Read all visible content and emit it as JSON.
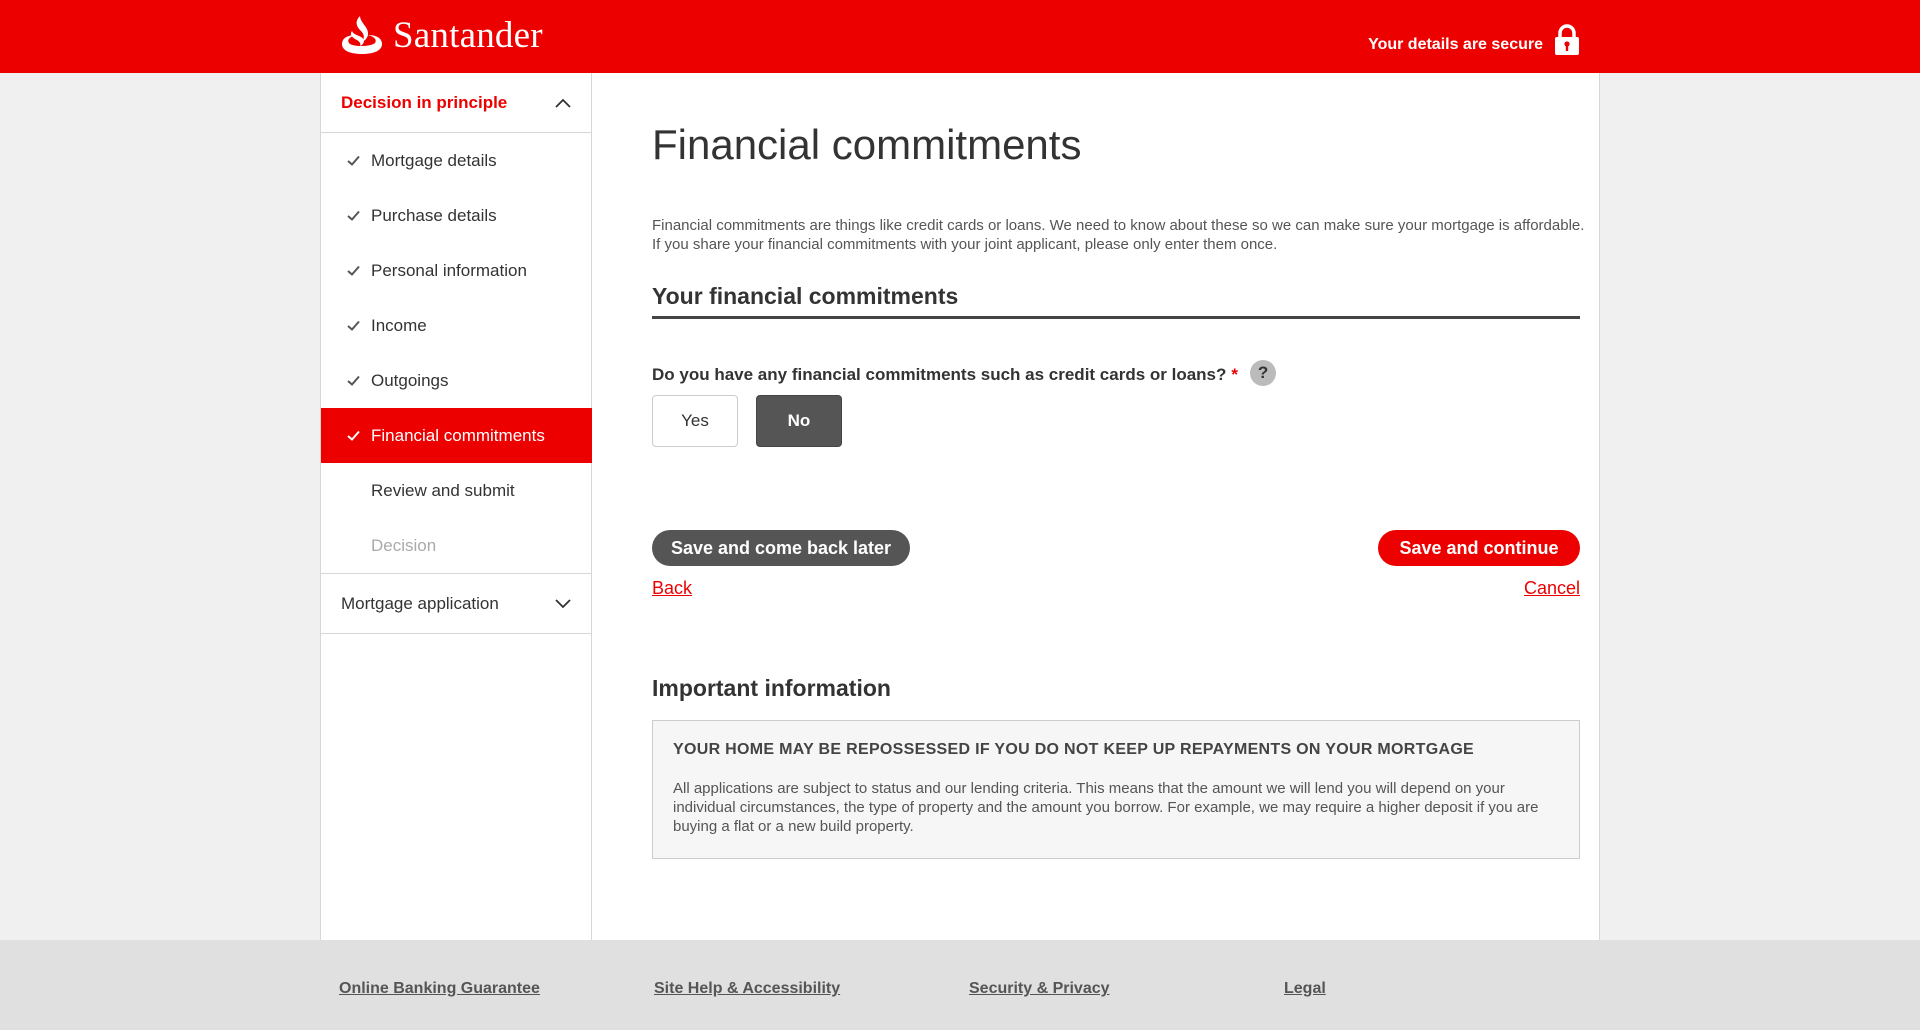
{
  "header": {
    "brand": "Santander",
    "secure_text": "Your details are secure"
  },
  "sidebar": {
    "section_title": "Decision in principle",
    "steps": [
      {
        "label": "Mortgage details",
        "state": "complete"
      },
      {
        "label": "Purchase details",
        "state": "complete"
      },
      {
        "label": "Personal information",
        "state": "complete"
      },
      {
        "label": "Income",
        "state": "complete"
      },
      {
        "label": "Outgoings",
        "state": "complete"
      },
      {
        "label": "Financial commitments",
        "state": "active"
      },
      {
        "label": "Review and submit",
        "state": "pending"
      },
      {
        "label": "Decision",
        "state": "disabled"
      }
    ],
    "collapsed_section": "Mortgage application"
  },
  "main": {
    "title": "Financial commitments",
    "intro": "Financial commitments are things like credit cards or loans. We need to know about these so we can make sure your mortgage is affordable. If you share your financial commitments with your joint applicant, please only enter them once.",
    "section_title": "Your financial commitments",
    "question": "Do you have any financial commitments such as credit cards or loans?",
    "required_marker": "*",
    "help_label": "?",
    "options": {
      "yes": "Yes",
      "no": "No",
      "selected": "No"
    },
    "buttons": {
      "save_later": "Save and come back later",
      "save_continue": "Save and continue",
      "back": "Back",
      "cancel": "Cancel"
    },
    "important": {
      "title": "Important information",
      "heading": "YOUR HOME MAY BE REPOSSESSED IF YOU DO NOT KEEP UP REPAYMENTS ON YOUR MORTGAGE",
      "text": "All applications are subject to status and our lending criteria. This means that the amount we will lend you will depend on your individual circumstances, the type of property and the amount you borrow. For example, we may require a higher deposit if you are buying a flat or a new build property."
    }
  },
  "footer": {
    "links": [
      "Online Banking Guarantee",
      "Site Help & Accessibility",
      "Security & Privacy",
      "Legal"
    ]
  },
  "colors": {
    "brand_red": "#ec0000",
    "dark_button": "#555555"
  }
}
